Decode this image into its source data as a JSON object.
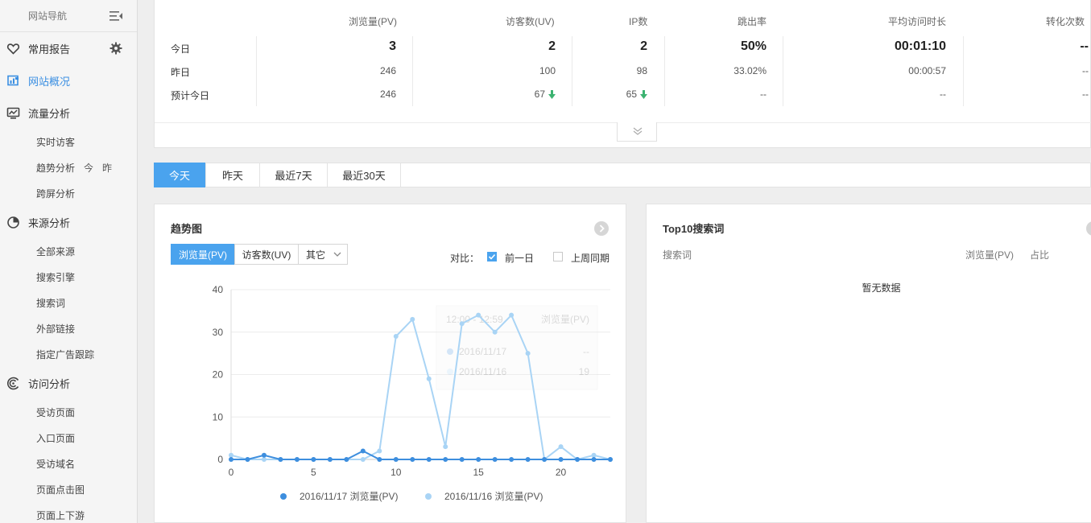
{
  "sidebar": {
    "title": "网站导航",
    "groups": [
      {
        "label": "常用报告",
        "icon": "heart-icon",
        "items": []
      },
      {
        "label": "网站概况",
        "icon": "overview-icon",
        "active": true,
        "items": []
      },
      {
        "label": "流量分析",
        "icon": "monitor-chart-icon",
        "items": [
          {
            "label": "实时访客"
          },
          {
            "label": "趋势分析",
            "extra": "今",
            "extra2": "昨"
          },
          {
            "label": "跨屏分析"
          }
        ]
      },
      {
        "label": "来源分析",
        "icon": "pie-icon",
        "items": [
          {
            "label": "全部来源"
          },
          {
            "label": "搜索引擎"
          },
          {
            "label": "搜索词"
          },
          {
            "label": "外部链接"
          },
          {
            "label": "指定广告跟踪"
          }
        ]
      },
      {
        "label": "访问分析",
        "icon": "spiral-icon",
        "items": [
          {
            "label": "受访页面"
          },
          {
            "label": "入口页面"
          },
          {
            "label": "受访域名"
          },
          {
            "label": "页面点击图"
          },
          {
            "label": "页面上下游"
          }
        ]
      }
    ]
  },
  "stats": {
    "headers": [
      "浏览量(PV)",
      "访客数(UV)",
      "IP数",
      "跳出率",
      "平均访问时长",
      "转化次数"
    ],
    "rows": [
      {
        "label": "今日",
        "values": [
          "3",
          "2",
          "2",
          "50%",
          "00:01:10",
          "--"
        ]
      },
      {
        "label": "昨日",
        "values": [
          "246",
          "100",
          "98",
          "33.02%",
          "00:00:57",
          "--"
        ]
      },
      {
        "label": "预计今日",
        "values": [
          "246",
          "67",
          "65",
          "--",
          "--",
          "--"
        ]
      }
    ],
    "down_color": "#3cb371"
  },
  "date_tabs": [
    "今天",
    "昨天",
    "最近7天",
    "最近30天"
  ],
  "trend": {
    "title": "趋势图",
    "metric_tabs": [
      "浏览量(PV)",
      "访客数(UV)",
      "其它"
    ],
    "compare_label": "对比：",
    "compare_options": [
      {
        "label": "前一日",
        "checked": true
      },
      {
        "label": "上周同期",
        "checked": false
      }
    ]
  },
  "chart_data": {
    "type": "line",
    "x": [
      0,
      1,
      2,
      3,
      4,
      5,
      6,
      7,
      8,
      9,
      10,
      11,
      12,
      13,
      14,
      15,
      16,
      17,
      18,
      19,
      20,
      21,
      22,
      23
    ],
    "xticks": [
      0,
      5,
      10,
      15,
      20
    ],
    "ylim": [
      0,
      40
    ],
    "yticks": [
      0,
      10,
      20,
      30,
      40
    ],
    "grid": true,
    "legend_position": "bottom",
    "series": [
      {
        "name": "2016/11/17 浏览量(PV)",
        "color": "#3d8ede",
        "values": [
          0,
          0,
          1,
          0,
          0,
          0,
          0,
          0,
          2,
          0,
          0,
          0,
          0,
          0,
          0,
          0,
          0,
          0,
          0,
          0,
          0,
          0,
          0,
          0
        ]
      },
      {
        "name": "2016/11/16 浏览量(PV)",
        "color": "#a9d4f5",
        "values": [
          1,
          0,
          0,
          0,
          0,
          0,
          0,
          0,
          0,
          2,
          29,
          33,
          19,
          3,
          32,
          34,
          30,
          34,
          25,
          0,
          3,
          0,
          1,
          0
        ]
      }
    ],
    "tooltip": {
      "time": "12:00 - 12:59",
      "metric": "浏览量(PV)",
      "rows": [
        {
          "date": "2016/11/17",
          "value": "--"
        },
        {
          "date": "2016/11/16",
          "value": "19"
        }
      ]
    }
  },
  "top10": {
    "title": "Top10搜索词",
    "columns": [
      "搜索词",
      "浏览量(PV)",
      "占比"
    ],
    "empty_text": "暂无数据"
  }
}
